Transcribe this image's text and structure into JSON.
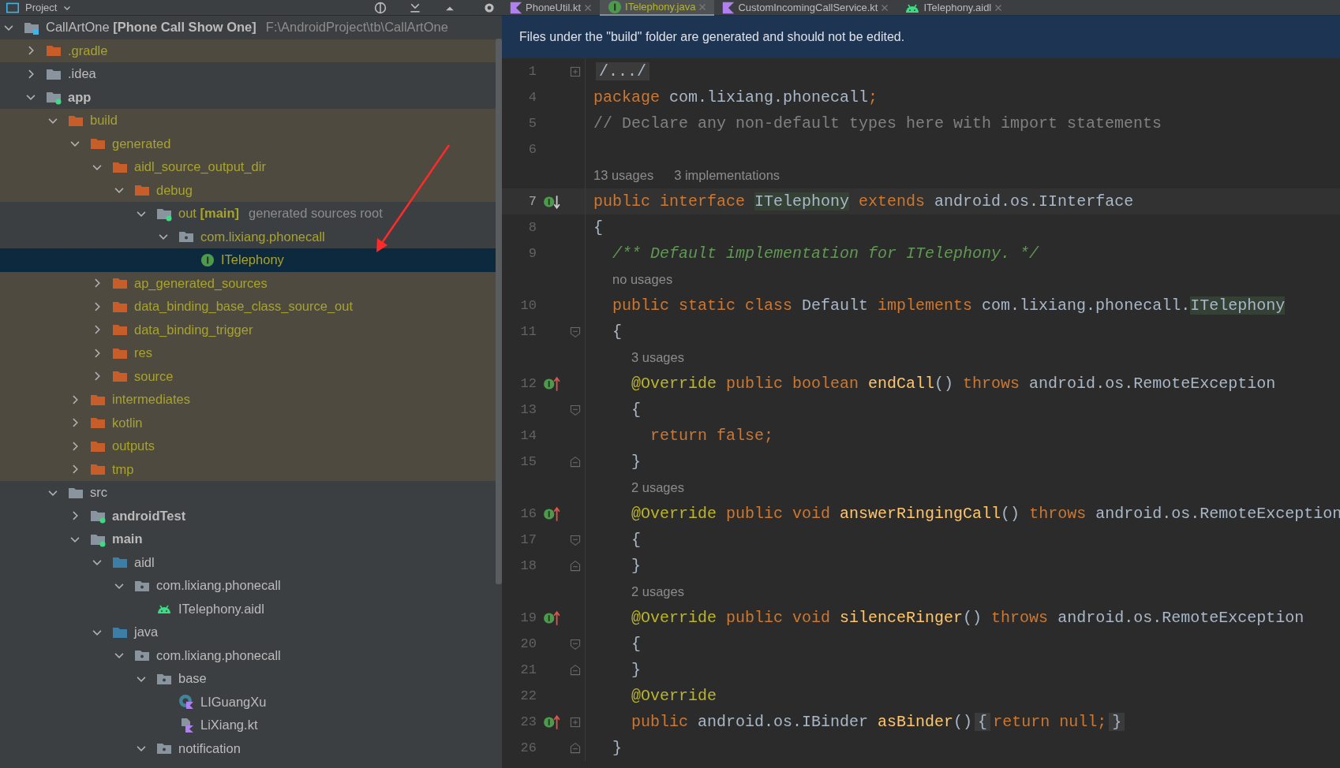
{
  "project_header": {
    "title": "Project"
  },
  "tabs": [
    {
      "label": "PhoneUtil.kt",
      "kind": "kotlin",
      "selected": false
    },
    {
      "label": "ITelephony.java",
      "kind": "interface",
      "selected": true
    },
    {
      "label": "CustomIncomingCallService.kt",
      "kind": "kotlin",
      "selected": false
    },
    {
      "label": "ITelephony.aidl",
      "kind": "android",
      "selected": false
    }
  ],
  "banner": {
    "text": "Files under the \"build\" folder are generated and should not be edited."
  },
  "tree": [
    {
      "label": "CallArtOne **[Phone Call Show One]**",
      "hint": "F:\\AndroidProject\\tb\\CallArtOne",
      "kind": "project",
      "expanded": true,
      "selected": false,
      "excluded": false,
      "generated": false,
      "bold": false,
      "children": [
        {
          "label": ".gradle",
          "kind": "folder-orange",
          "expanded": false,
          "selected": false,
          "excluded": true,
          "generated": true,
          "bold": false
        },
        {
          "label": ".idea",
          "kind": "folder-gray",
          "expanded": false,
          "selected": false,
          "excluded": false,
          "generated": false,
          "bold": false
        },
        {
          "label": "app",
          "kind": "module",
          "expanded": true,
          "selected": false,
          "excluded": false,
          "generated": false,
          "bold": true,
          "children": [
            {
              "label": "build",
              "kind": "folder-orange",
              "expanded": true,
              "selected": false,
              "excluded": true,
              "generated": true,
              "bold": false,
              "children": [
                {
                  "label": "generated",
                  "kind": "folder-orange",
                  "expanded": true,
                  "selected": false,
                  "excluded": true,
                  "generated": true,
                  "bold": false,
                  "children": [
                    {
                      "label": "aidl_source_output_dir",
                      "kind": "folder-orange",
                      "expanded": true,
                      "selected": false,
                      "excluded": true,
                      "generated": true,
                      "bold": false,
                      "children": [
                        {
                          "label": "debug",
                          "kind": "folder-orange",
                          "expanded": true,
                          "selected": false,
                          "excluded": true,
                          "generated": true,
                          "bold": false,
                          "children": [
                            {
                              "label": "out **[main]**",
                              "hint": "generated sources root",
                              "kind": "module",
                              "expanded": true,
                              "selected": false,
                              "excluded": false,
                              "generated": true,
                              "bold": false,
                              "children": [
                                {
                                  "label": "com.lixiang.phonecall",
                                  "kind": "package",
                                  "expanded": true,
                                  "selected": false,
                                  "excluded": false,
                                  "generated": true,
                                  "bold": false,
                                  "children": [
                                    {
                                      "label": "ITelephony",
                                      "kind": "interface",
                                      "selected": true,
                                      "excluded": false,
                                      "generated": true,
                                      "bold": false
                                    }
                                  ]
                                }
                              ]
                            }
                          ]
                        }
                      ]
                    },
                    {
                      "label": "ap_generated_sources",
                      "kind": "folder-orange",
                      "expanded": false,
                      "selected": false,
                      "excluded": true,
                      "generated": true,
                      "bold": false
                    },
                    {
                      "label": "data_binding_base_class_source_out",
                      "kind": "folder-orange",
                      "expanded": false,
                      "selected": false,
                      "excluded": true,
                      "generated": true,
                      "bold": false
                    },
                    {
                      "label": "data_binding_trigger",
                      "kind": "folder-orange",
                      "expanded": false,
                      "selected": false,
                      "excluded": true,
                      "generated": true,
                      "bold": false
                    },
                    {
                      "label": "res",
                      "kind": "folder-orange",
                      "expanded": false,
                      "selected": false,
                      "excluded": true,
                      "generated": true,
                      "bold": false
                    },
                    {
                      "label": "source",
                      "kind": "folder-orange",
                      "expanded": false,
                      "selected": false,
                      "excluded": true,
                      "generated": true,
                      "bold": false
                    }
                  ]
                },
                {
                  "label": "intermediates",
                  "kind": "folder-orange",
                  "expanded": false,
                  "selected": false,
                  "excluded": true,
                  "generated": true,
                  "bold": false
                },
                {
                  "label": "kotlin",
                  "kind": "folder-orange",
                  "expanded": false,
                  "selected": false,
                  "excluded": true,
                  "generated": true,
                  "bold": false
                },
                {
                  "label": "outputs",
                  "kind": "folder-orange",
                  "expanded": false,
                  "selected": false,
                  "excluded": true,
                  "generated": true,
                  "bold": false
                },
                {
                  "label": "tmp",
                  "kind": "folder-orange",
                  "expanded": false,
                  "selected": false,
                  "excluded": true,
                  "generated": true,
                  "bold": false
                }
              ]
            },
            {
              "label": "src",
              "kind": "folder-gray",
              "expanded": true,
              "selected": false,
              "excluded": false,
              "generated": false,
              "bold": false,
              "children": [
                {
                  "label": "androidTest",
                  "kind": "module",
                  "expanded": false,
                  "selected": false,
                  "excluded": false,
                  "generated": false,
                  "bold": true
                },
                {
                  "label": "main",
                  "kind": "module",
                  "expanded": true,
                  "selected": false,
                  "excluded": false,
                  "generated": false,
                  "bold": true,
                  "children": [
                    {
                      "label": "aidl",
                      "kind": "folder-blue",
                      "expanded": true,
                      "selected": false,
                      "excluded": false,
                      "generated": false,
                      "bold": false,
                      "children": [
                        {
                          "label": "com.lixiang.phonecall",
                          "kind": "package",
                          "expanded": true,
                          "selected": false,
                          "excluded": false,
                          "generated": false,
                          "bold": false,
                          "children": [
                            {
                              "label": "ITelephony.aidl",
                              "kind": "android",
                              "selected": false,
                              "excluded": false,
                              "generated": false,
                              "bold": false
                            }
                          ]
                        }
                      ]
                    },
                    {
                      "label": "java",
                      "kind": "folder-blue",
                      "expanded": true,
                      "selected": false,
                      "excluded": false,
                      "generated": false,
                      "bold": false,
                      "children": [
                        {
                          "label": "com.lixiang.phonecall",
                          "kind": "package",
                          "expanded": true,
                          "selected": false,
                          "excluded": false,
                          "generated": false,
                          "bold": false,
                          "children": [
                            {
                              "label": "base",
                              "kind": "package",
                              "expanded": true,
                              "selected": false,
                              "excluded": false,
                              "generated": false,
                              "bold": false,
                              "children": [
                                {
                                  "label": "LIGuangXu",
                                  "kind": "kotlin-class",
                                  "selected": false,
                                  "excluded": false,
                                  "generated": false,
                                  "bold": false
                                },
                                {
                                  "label": "LiXiang.kt",
                                  "kind": "kotlin-file",
                                  "selected": false,
                                  "excluded": false,
                                  "generated": false,
                                  "bold": false
                                }
                              ]
                            },
                            {
                              "label": "notification",
                              "kind": "package",
                              "expanded": true,
                              "selected": false,
                              "excluded": false,
                              "generated": false,
                              "bold": false
                            }
                          ]
                        }
                      ]
                    }
                  ]
                }
              ]
            }
          ]
        }
      ]
    }
  ],
  "editor": {
    "lines": [
      {
        "kind": "code",
        "num": "1",
        "fold": {
          "kind": "collapsed"
        },
        "current": false,
        "tokens": [
          {
            "kind": "folded",
            "text": "/.../"
          }
        ]
      },
      {
        "kind": "code",
        "num": "4",
        "current": false,
        "tokens": [
          {
            "kind": "kw",
            "text": "package"
          },
          {
            "kind": "plain",
            "text": " com.lixiang.phonecall"
          },
          {
            "kind": "kw",
            "text": ";"
          }
        ]
      },
      {
        "kind": "code",
        "num": "5",
        "current": false,
        "tokens": [
          {
            "kind": "comment",
            "text": "// Declare any non-default types here with import statements"
          }
        ]
      },
      {
        "kind": "code",
        "num": "6",
        "current": false
      },
      {
        "kind": "hint",
        "texts": [
          "13 usages",
          "3 implementations"
        ]
      },
      {
        "kind": "code",
        "num": "7",
        "gutter": {
          "kind": "implemented"
        },
        "current": true,
        "tokens": [
          {
            "kind": "kw",
            "text": "public interface "
          },
          {
            "kind": "hl",
            "text": "ITelephony"
          },
          {
            "kind": "kw",
            "text": " extends"
          },
          {
            "kind": "plain",
            "text": " android.os.IInterface"
          }
        ]
      },
      {
        "kind": "code",
        "num": "8",
        "current": false,
        "tokens": [
          {
            "kind": "plain",
            "text": "{"
          }
        ]
      },
      {
        "kind": "code",
        "num": "9",
        "current": false,
        "tokens": [
          {
            "kind": "doc",
            "text": "  /** Default implementation for ITelephony. */"
          }
        ]
      },
      {
        "kind": "hint",
        "texts": [
          "no usages"
        ]
      },
      {
        "kind": "code",
        "num": "10",
        "current": false,
        "tokens": [
          {
            "kind": "kw",
            "text": "  public static class "
          },
          {
            "kind": "plain",
            "text": "Default "
          },
          {
            "kind": "kw",
            "text": "implements"
          },
          {
            "kind": "plain",
            "text": " com.lixiang.phonecall."
          },
          {
            "kind": "hl",
            "text": "ITelephony"
          }
        ]
      },
      {
        "kind": "code",
        "num": "11",
        "fold": {
          "kind": "open"
        },
        "current": false,
        "tokens": [
          {
            "kind": "plain",
            "text": "  {"
          }
        ]
      },
      {
        "kind": "hint",
        "texts": [
          "3 usages"
        ]
      },
      {
        "kind": "code",
        "num": "12",
        "gutter": {
          "kind": "override"
        },
        "current": false,
        "tokens": [
          {
            "kind": "ann",
            "text": "    @Override"
          },
          {
            "kind": "kw",
            "text": " public boolean "
          },
          {
            "kind": "fn",
            "text": "endCall"
          },
          {
            "kind": "plain",
            "text": "() "
          },
          {
            "kind": "kw",
            "text": "throws"
          },
          {
            "kind": "plain",
            "text": " android.os.RemoteException"
          }
        ]
      },
      {
        "kind": "code",
        "num": "13",
        "fold": {
          "kind": "open"
        },
        "current": false,
        "tokens": [
          {
            "kind": "plain",
            "text": "    {"
          }
        ]
      },
      {
        "kind": "code",
        "num": "14",
        "current": false,
        "tokens": [
          {
            "kind": "kw",
            "text": "      return false;"
          }
        ]
      },
      {
        "kind": "code",
        "num": "15",
        "fold": {
          "kind": "close"
        },
        "current": false,
        "tokens": [
          {
            "kind": "plain",
            "text": "    }"
          }
        ]
      },
      {
        "kind": "hint",
        "texts": [
          "2 usages"
        ]
      },
      {
        "kind": "code",
        "num": "16",
        "gutter": {
          "kind": "override"
        },
        "current": false,
        "tokens": [
          {
            "kind": "ann",
            "text": "    @Override"
          },
          {
            "kind": "kw",
            "text": " public void "
          },
          {
            "kind": "fn",
            "text": "answerRingingCall"
          },
          {
            "kind": "plain",
            "text": "() "
          },
          {
            "kind": "kw",
            "text": "throws"
          },
          {
            "kind": "plain",
            "text": " android.os.RemoteException"
          }
        ]
      },
      {
        "kind": "code",
        "num": "17",
        "fold": {
          "kind": "open"
        },
        "current": false,
        "tokens": [
          {
            "kind": "plain",
            "text": "    {"
          }
        ]
      },
      {
        "kind": "code",
        "num": "18",
        "fold": {
          "kind": "close"
        },
        "current": false,
        "tokens": [
          {
            "kind": "plain",
            "text": "    }"
          }
        ]
      },
      {
        "kind": "hint",
        "texts": [
          "2 usages"
        ]
      },
      {
        "kind": "code",
        "num": "19",
        "gutter": {
          "kind": "override"
        },
        "current": false,
        "tokens": [
          {
            "kind": "ann",
            "text": "    @Override"
          },
          {
            "kind": "kw",
            "text": " public void "
          },
          {
            "kind": "fn",
            "text": "silenceRinger"
          },
          {
            "kind": "plain",
            "text": "() "
          },
          {
            "kind": "kw",
            "text": "throws"
          },
          {
            "kind": "plain",
            "text": " android.os.RemoteException"
          }
        ]
      },
      {
        "kind": "code",
        "num": "20",
        "fold": {
          "kind": "open"
        },
        "current": false,
        "tokens": [
          {
            "kind": "plain",
            "text": "    {"
          }
        ]
      },
      {
        "kind": "code",
        "num": "21",
        "fold": {
          "kind": "close"
        },
        "current": false,
        "tokens": [
          {
            "kind": "plain",
            "text": "    }"
          }
        ]
      },
      {
        "kind": "code",
        "num": "22",
        "current": false,
        "tokens": [
          {
            "kind": "ann",
            "text": "    @Override"
          }
        ]
      },
      {
        "kind": "code",
        "num": "23",
        "gutter": {
          "kind": "override"
        },
        "fold": {
          "kind": "collapsed"
        },
        "current": false,
        "tokens": [
          {
            "kind": "kw",
            "text": "    public"
          },
          {
            "kind": "plain",
            "text": " android.os.IBinder "
          },
          {
            "kind": "fn",
            "text": "asBinder"
          },
          {
            "kind": "plain",
            "text": "()"
          },
          {
            "kind": "folded",
            "text": "{"
          },
          {
            "kind": "kw",
            "text": "return null;"
          },
          {
            "kind": "folded",
            "text": "}"
          }
        ]
      },
      {
        "kind": "code",
        "num": "26",
        "fold": {
          "kind": "close"
        },
        "current": false,
        "tokens": [
          {
            "kind": "plain",
            "text": "  }"
          }
        ]
      }
    ]
  }
}
